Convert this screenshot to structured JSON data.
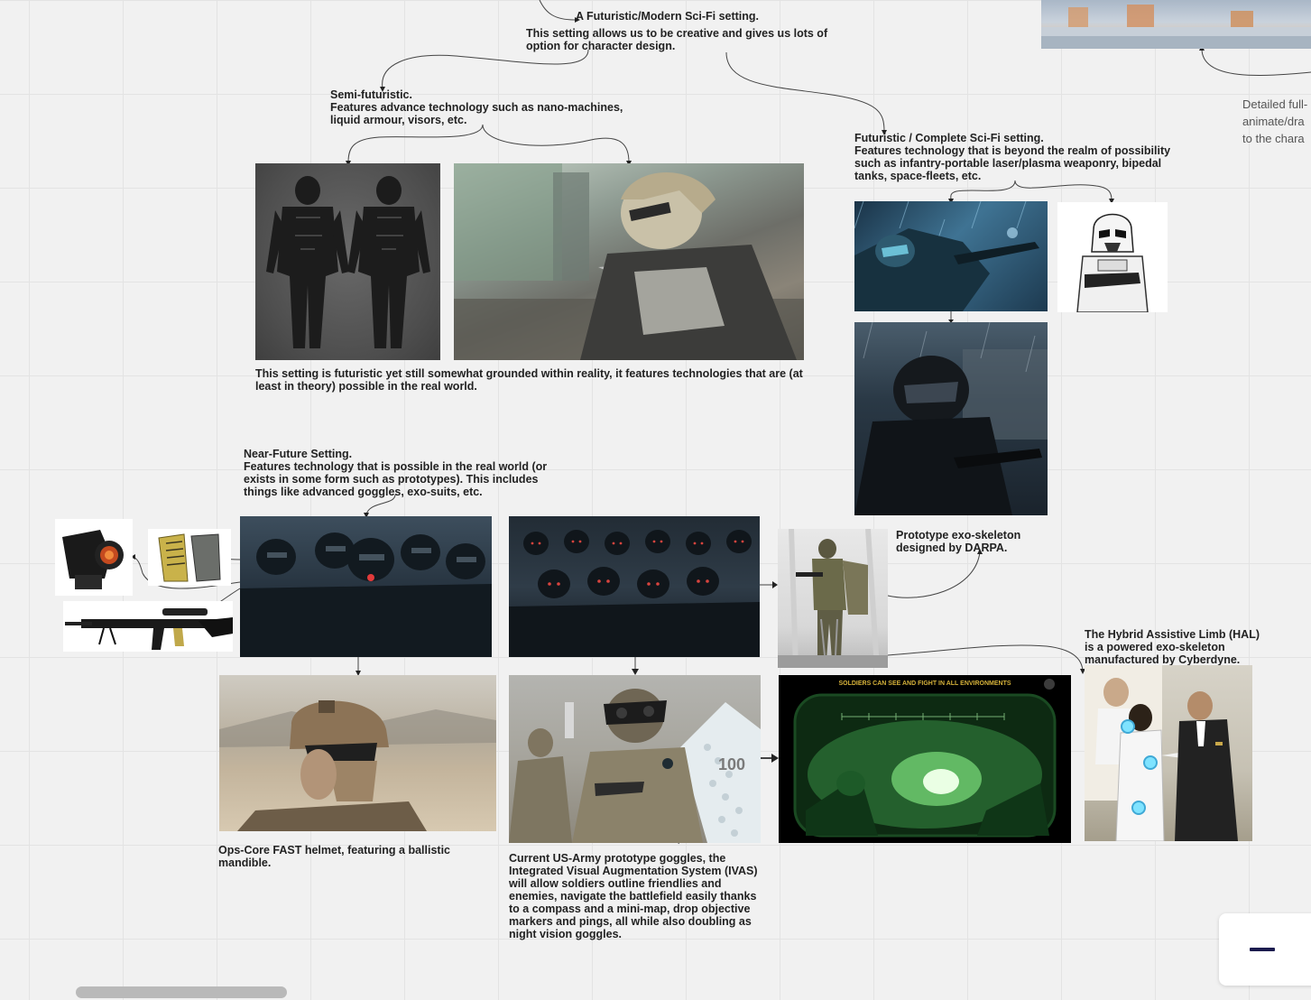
{
  "notes": {
    "top": "A Futuristic/Modern Sci-Fi setting.",
    "top_sub": "This setting allows us to be creative and gives us lots of\noption for character design.",
    "semi": "Semi-futuristic.\nFeatures advance technology such as nano-machines,\nliquid armour, visors, etc.",
    "semi_caption": "This setting is futuristic yet still somewhat grounded within reality, it features technologies that are (at\nleast in theory) possible in the real world.",
    "complete": "Futuristic / Complete Sci-Fi setting.\nFeatures technology that is beyond the realm of possibility\nsuch as infantry-portable laser/plasma weaponry, bipedal\ntanks, space-fleets, etc.",
    "near": "Near-Future Setting.\nFeatures technology that is possible in the real world (or\nexists in some form such as prototypes). This includes\nthings like advanced goggles, exo-suits, etc.",
    "darpa": "Prototype exo-skeleton\ndesigned by DARPA.",
    "hal": "The Hybrid Assistive Limb (HAL)\nis a powered exo-skeleton\nmanufactured by Cyberdyne.",
    "fast": "Ops-Core FAST helmet, featuring a ballistic\nmandible.",
    "ivas": "Current US-Army prototype goggles, the\nIntegrated Visual Augmentation System (IVAS)\nwill allow soldiers outline friendlies and\nenemies, navigate the battlefield easily thanks\nto a compass and a mini-map, drop objective\nmarkers and pings, all while also doubling as\nnight vision goggles.",
    "right_cut": "Detailed full-\nanimate/dra\nto the chara"
  },
  "images": {
    "nightvision_banner": "SOLDIERS CAN SEE AND FIGHT IN ALL ENVIRONMENTS",
    "wall_number": "100"
  },
  "colors": {
    "canvas": "#f1f1f1",
    "grid": "#e3e3e3",
    "zoom_icon": "#1b1b4e"
  }
}
